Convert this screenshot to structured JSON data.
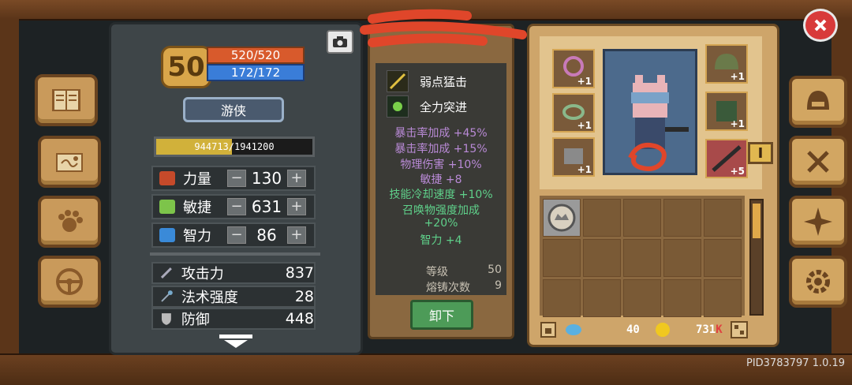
{
  "level": "50",
  "hp": "520/520",
  "mp": "172/172",
  "class_name": "游侠",
  "xp": {
    "text": "944713/1941200",
    "fraction": 0.487
  },
  "attributes": [
    {
      "name": "力量",
      "value": "130",
      "icon": "strength-icon",
      "color": "#c64a2a"
    },
    {
      "name": "敏捷",
      "value": "631",
      "icon": "agility-icon",
      "color": "#7dc44a"
    },
    {
      "name": "智力",
      "value": "86",
      "icon": "intelligence-icon",
      "color": "#3a8ad8"
    }
  ],
  "stats": [
    {
      "name": "攻击力",
      "value": "837",
      "icon": "sword-icon"
    },
    {
      "name": "法术强度",
      "value": "28",
      "icon": "wand-icon"
    },
    {
      "name": "防御",
      "value": "448",
      "icon": "shield-icon"
    }
  ],
  "item": {
    "skills": [
      {
        "name": "弱点猛击",
        "icon": "weak-strike-skill-icon"
      },
      {
        "name": "全力突进",
        "icon": "dash-skill-icon"
      }
    ],
    "affixes": [
      {
        "text": "暴击率加成 +45%",
        "kind": "purple"
      },
      {
        "text": "暴击率加成 +15%",
        "kind": "purple"
      },
      {
        "text": "物理伤害 +10%",
        "kind": "purple"
      },
      {
        "text": "敏捷 +8",
        "kind": "purple"
      },
      {
        "text": "技能冷却速度 +10%",
        "kind": "green"
      },
      {
        "text": "召唤物强度加成",
        "kind": "green"
      },
      {
        "text": "+20%",
        "kind": "green"
      },
      {
        "text": "智力 +4",
        "kind": "green"
      }
    ],
    "level_label": "等级",
    "level_value": "50",
    "forge_label": "熔铸次数",
    "forge_value": "9",
    "unequip_label": "卸下"
  },
  "equipment": {
    "slots": [
      {
        "name": "necklace-slot",
        "bonus": "+1"
      },
      {
        "name": "ring-slot",
        "bonus": "+1"
      },
      {
        "name": "gloves-slot",
        "bonus": "+1"
      },
      {
        "name": "helmet-slot",
        "bonus": "+1"
      },
      {
        "name": "armor-slot",
        "bonus": "+1"
      },
      {
        "name": "weapon-slot",
        "bonus": "+5"
      }
    ],
    "tab_marker": "I"
  },
  "currency": {
    "gems": "40",
    "gold": "731",
    "gold_suffix": "K"
  },
  "watermark": "PID3783797 1.0.19",
  "colors": {
    "hp": "#d85a2c",
    "mp": "#3a7dd8",
    "unequip": "#4d9b58",
    "close": "#d83a3a"
  }
}
